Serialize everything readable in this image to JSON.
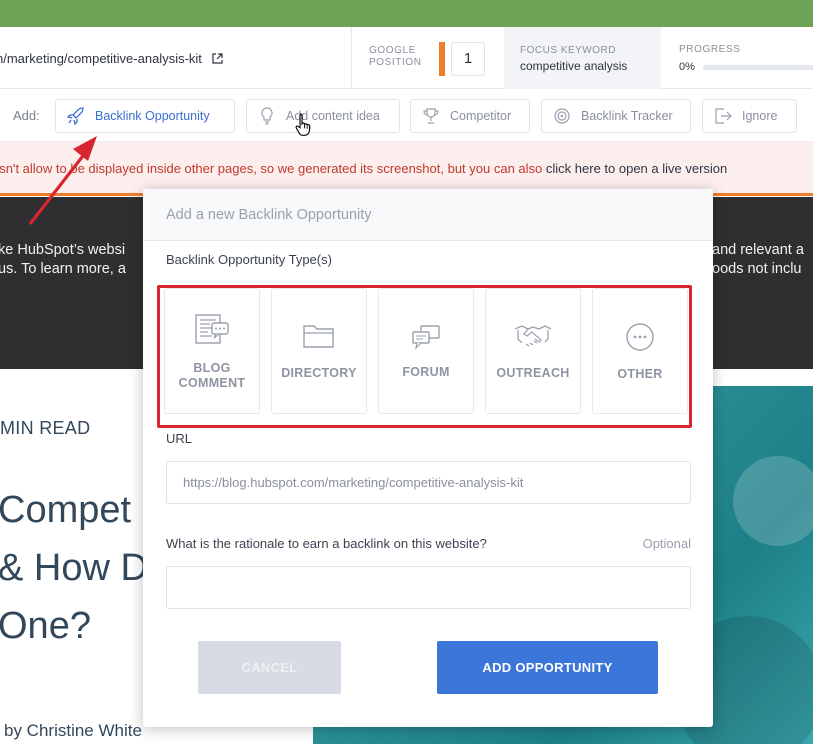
{
  "topbar": {
    "url": "n/marketing/competitive-analysis-kit",
    "google_position_label": "GOOGLE POSITION",
    "google_position_value": "1",
    "focus_keyword_label": "FOCUS KEYWORD",
    "focus_keyword_value": "competitive analysis",
    "progress_label": "PROGRESS",
    "progress_value": "0%",
    "progress_fraction": 0,
    "accent_color": "#ee7d2a"
  },
  "addbar": {
    "label": "Add:",
    "buttons": [
      {
        "label": "Backlink Opportunity",
        "icon": "rocket-icon"
      },
      {
        "label": "Add content idea",
        "icon": "lightbulb-icon"
      },
      {
        "label": "Competitor",
        "icon": "trophy-icon"
      },
      {
        "label": "Backlink Tracker",
        "icon": "target-icon"
      },
      {
        "label": "Ignore",
        "icon": "exit-icon"
      }
    ]
  },
  "notice": {
    "text": "esn't allow to be displayed inside other pages, so we generated its screenshot, but you can also ",
    "link": "click here to open a live version"
  },
  "darkband": {
    "left_line1": "ke HubSpot’s websi",
    "left_line2": "us. To learn more, a",
    "right_line1": "and relevant a",
    "right_line2": "oods not inclu"
  },
  "article": {
    "read_time": "MIN READ",
    "headline_lines": [
      "Compet",
      "& How D",
      "One?"
    ],
    "author": "by Christine White"
  },
  "modal": {
    "title": "Add a new Backlink Opportunity",
    "type_label": "Backlink Opportunity Type(s)",
    "types": [
      {
        "label_lines": [
          "BLOG",
          "COMMENT"
        ],
        "icon": "blog-comment-icon"
      },
      {
        "label_lines": [
          "DIRECTORY"
        ],
        "icon": "folder-icon"
      },
      {
        "label_lines": [
          "FORUM"
        ],
        "icon": "chat-bubbles-icon"
      },
      {
        "label_lines": [
          "OUTREACH"
        ],
        "icon": "handshake-icon"
      },
      {
        "label_lines": [
          "OTHER"
        ],
        "icon": "ellipsis-circle-icon"
      }
    ],
    "url_label": "URL",
    "url_value": "https://blog.hubspot.com/marketing/competitive-analysis-kit",
    "rationale_label": "What is the rationale to earn a backlink on this website?",
    "optional_label": "Optional",
    "rationale_value": "",
    "cancel_label": "CANCEL",
    "add_label": "ADD OPPORTUNITY",
    "primary_color": "#3b76d8",
    "highlight_color": "#d9262e"
  }
}
